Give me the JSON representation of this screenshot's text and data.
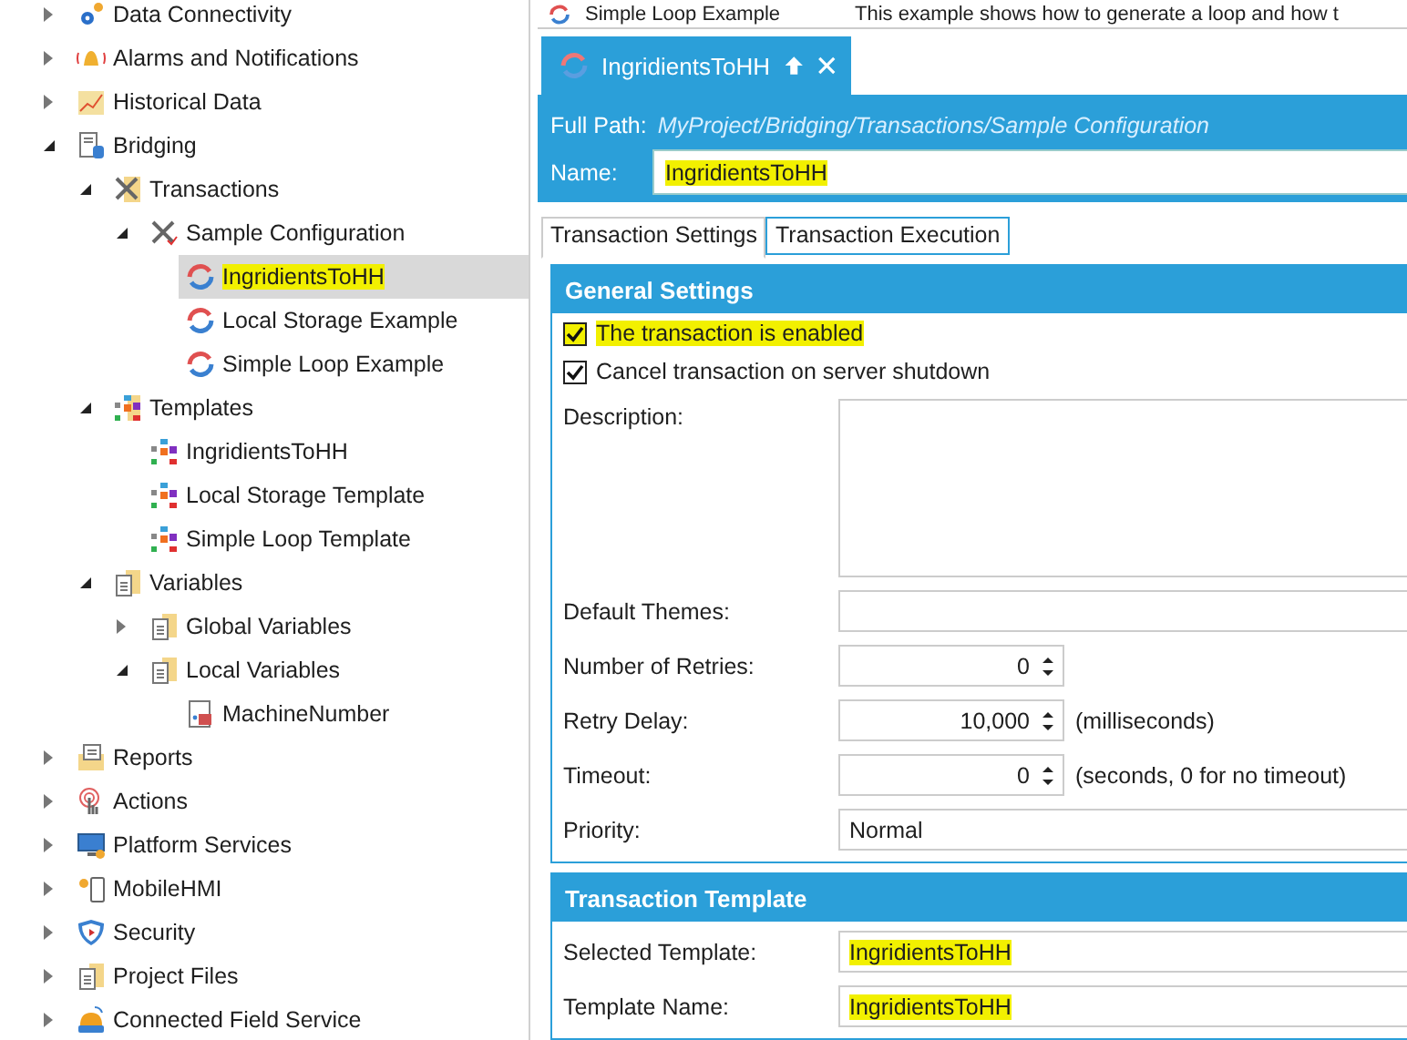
{
  "top_strip": {
    "name": "Simple Loop Example",
    "description": "This example shows how to generate a loop and how t"
  },
  "tree": [
    {
      "label": "Data Connectivity",
      "kind": "gear",
      "expanded": false,
      "selected": false
    },
    {
      "label": "Alarms and Notifications",
      "kind": "bell",
      "expanded": false,
      "selected": false
    },
    {
      "label": "Historical Data",
      "kind": "chart",
      "expanded": false,
      "selected": false
    },
    {
      "label": "Bridging",
      "kind": "server",
      "expanded": true,
      "selected": false,
      "children": [
        {
          "label": "Transactions",
          "kind": "tools-folder",
          "expanded": true,
          "selected": false,
          "children": [
            {
              "label": "Sample Configuration",
              "kind": "tools",
              "expanded": true,
              "selected": false,
              "children": [
                {
                  "label": "IngridientsToHH",
                  "kind": "sync",
                  "selected": true,
                  "highlighted": true
                },
                {
                  "label": "Local Storage Example",
                  "kind": "sync",
                  "selected": false,
                  "highlighted": false
                },
                {
                  "label": "Simple Loop Example",
                  "kind": "sync",
                  "selected": false,
                  "highlighted": false
                }
              ]
            }
          ]
        },
        {
          "label": "Templates",
          "kind": "template-folder",
          "expanded": true,
          "selected": false,
          "children": [
            {
              "label": "IngridientsToHH",
              "kind": "template",
              "selected": false
            },
            {
              "label": "Local Storage Template",
              "kind": "template",
              "selected": false
            },
            {
              "label": "Simple Loop Template",
              "kind": "template",
              "selected": false
            }
          ]
        },
        {
          "label": "Variables",
          "kind": "doc-folder",
          "expanded": true,
          "selected": false,
          "children": [
            {
              "label": "Global Variables",
              "kind": "doc-folder",
              "expanded": false,
              "selected": false
            },
            {
              "label": "Local Variables",
              "kind": "doc-folder",
              "expanded": true,
              "selected": false,
              "children": [
                {
                  "label": "MachineNumber",
                  "kind": "variable",
                  "selected": false
                }
              ]
            }
          ]
        }
      ]
    },
    {
      "label": "Reports",
      "kind": "report",
      "expanded": false,
      "selected": false
    },
    {
      "label": "Actions",
      "kind": "touch",
      "expanded": false,
      "selected": false
    },
    {
      "label": "Platform Services",
      "kind": "monitor",
      "expanded": false,
      "selected": false
    },
    {
      "label": "MobileHMI",
      "kind": "phone",
      "expanded": false,
      "selected": false
    },
    {
      "label": "Security",
      "kind": "shield",
      "expanded": false,
      "selected": false
    },
    {
      "label": "Project Files",
      "kind": "doc-folder",
      "expanded": false,
      "selected": false
    },
    {
      "label": "Connected Field Service",
      "kind": "helmet",
      "expanded": false,
      "selected": false
    }
  ],
  "document_tab": {
    "title": "IngridientsToHH"
  },
  "header": {
    "full_path_label": "Full Path:",
    "full_path": "MyProject/Bridging/Transactions/Sample Configuration",
    "name_label": "Name:",
    "name_value": "IngridientsToHH",
    "name_highlighted": true
  },
  "tabs": [
    {
      "label": "Transaction Settings",
      "selected": true
    },
    {
      "label": "Transaction Execution",
      "selected": false
    }
  ],
  "general_settings": {
    "title": "General Settings",
    "checkboxes": [
      {
        "label": "The transaction is enabled",
        "checked": true,
        "highlighted": true
      },
      {
        "label": "Cancel transaction on server shutdown",
        "checked": true,
        "highlighted": false
      }
    ],
    "fields": [
      {
        "kind": "textarea",
        "label": "Description:"
      },
      {
        "kind": "text",
        "label": "Default Themes:"
      },
      {
        "kind": "spinner",
        "label": "Number of Retries:",
        "value": "0"
      },
      {
        "kind": "spinner",
        "label": "Retry Delay:",
        "value": "10,000",
        "unit": "(milliseconds)"
      },
      {
        "kind": "spinner",
        "label": "Timeout:",
        "value": "0",
        "unit": "(seconds, 0 for no timeout)"
      },
      {
        "kind": "text",
        "label": "Priority:",
        "value": "Normal"
      }
    ]
  },
  "transaction_template": {
    "title": "Transaction Template",
    "fields": [
      {
        "kind": "text",
        "label": "Selected Template:",
        "value": "IngridientsToHH",
        "highlighted": true
      },
      {
        "kind": "text",
        "label": "Template Name:",
        "value": "IngridientsToHH",
        "highlighted": true
      }
    ]
  }
}
